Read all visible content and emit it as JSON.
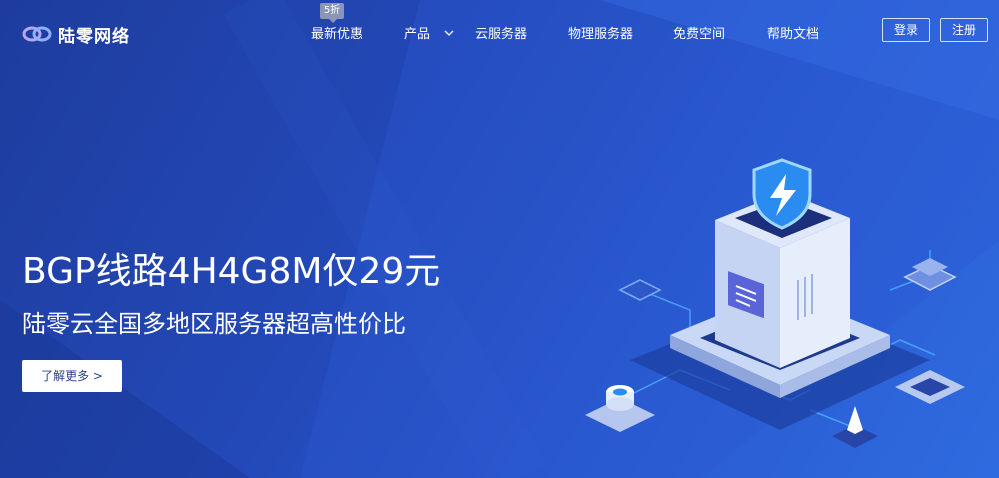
{
  "brand": {
    "name": "陆零网络"
  },
  "nav": {
    "badge": "5折",
    "items": [
      {
        "label": "最新优惠"
      },
      {
        "label": "产品"
      },
      {
        "label": "云服务器"
      },
      {
        "label": "物理服务器"
      },
      {
        "label": "免费空间"
      },
      {
        "label": "帮助文档"
      }
    ],
    "login": "登录",
    "register": "注册"
  },
  "hero": {
    "title": "BGP线路4H4G8M仅29元",
    "subtitle": "陆零云全国多地区服务器超高性价比",
    "cta": "了解更多 >"
  },
  "colors": {
    "bg_start": "#1e3c9e",
    "bg_end": "#2f6be0",
    "cta_text": "#2a3f8f",
    "badge_bg": "#8b95b8"
  },
  "icons": {
    "logo": "cloud-link-icon",
    "dropdown": "chevron-down-icon",
    "shield": "lightning-shield-icon"
  }
}
